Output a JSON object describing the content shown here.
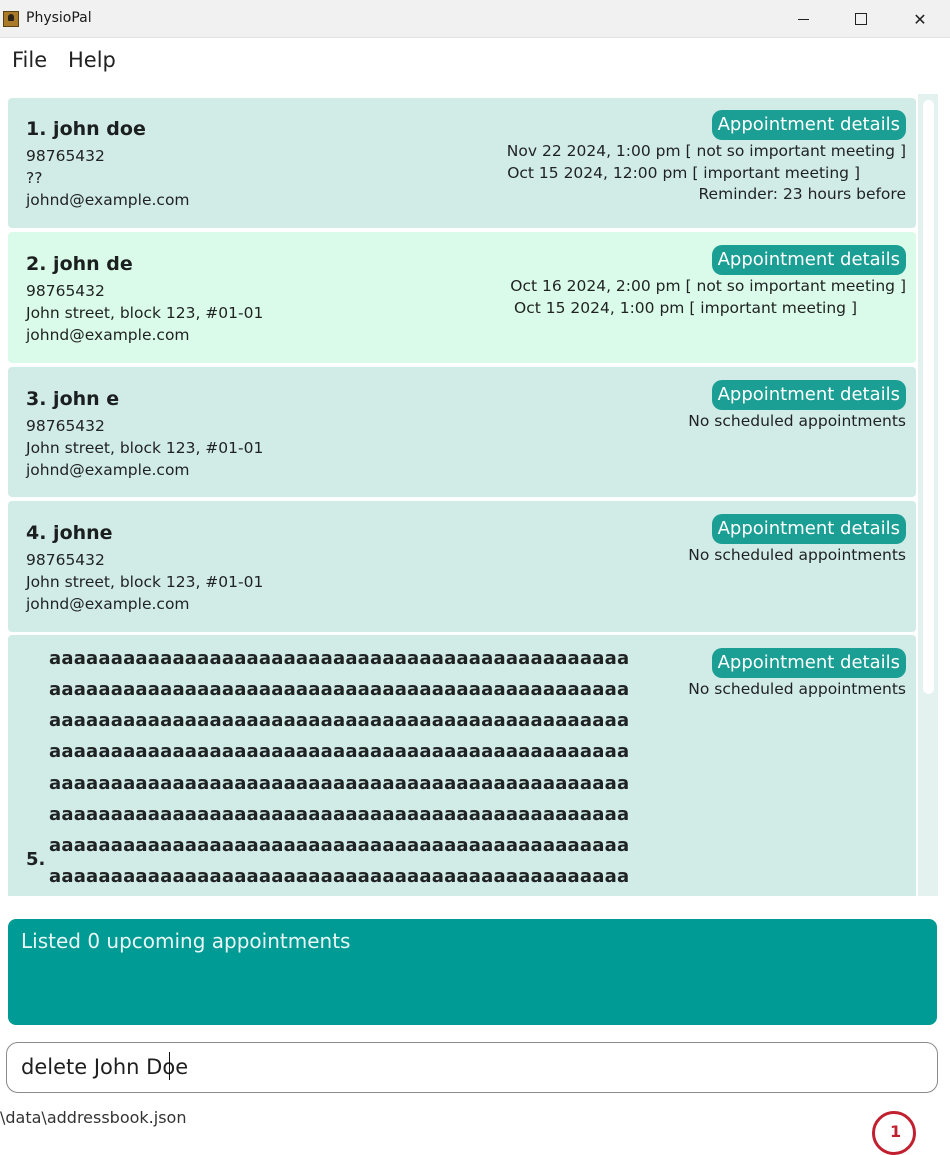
{
  "window": {
    "title": "PhysioPal",
    "minimize_label": "—",
    "maximize_label": "☐",
    "close_label": "✕"
  },
  "menu": {
    "items": [
      "File",
      "Help"
    ]
  },
  "patients": [
    {
      "name": "1. john doe",
      "phone": "98765432",
      "address": "??",
      "email": "johnd@example.com",
      "appointment_button": "Appointment details",
      "appointments": [
        "Nov 22 2024, 1:00 pm [ not so important meeting ]",
        "Oct 15 2024, 12:00 pm [ important meeting ]"
      ],
      "reminder": "Reminder: 23 hours before"
    },
    {
      "name": "2. john de",
      "phone": "98765432",
      "address": "John street, block 123, #01-01",
      "email": "johnd@example.com",
      "appointment_button": "Appointment details",
      "appointments": [
        "Oct 16 2024, 2:00 pm [ not so important meeting ]",
        "Oct 15 2024, 1:00 pm [ important meeting ]"
      ]
    },
    {
      "name": "3. john e",
      "phone": "98765432",
      "address": "John street, block 123, #01-01",
      "email": "johnd@example.com",
      "appointment_button": "Appointment details",
      "no_appointments": "No scheduled appointments"
    },
    {
      "name": "4. johne",
      "phone": "98765432",
      "address": "John street, block 123, #01-01",
      "email": "johnd@example.com",
      "appointment_button": "Appointment details",
      "no_appointments": "No scheduled appointments"
    },
    {
      "index": "5.",
      "name_lines": [
        "aaaaaaaaaaaaaaaaaaaaaaaaaaaaaaaaaaaaaaaaaaaaaaa",
        "aaaaaaaaaaaaaaaaaaaaaaaaaaaaaaaaaaaaaaaaaaaaaaa",
        "aaaaaaaaaaaaaaaaaaaaaaaaaaaaaaaaaaaaaaaaaaaaaaa",
        "aaaaaaaaaaaaaaaaaaaaaaaaaaaaaaaaaaaaaaaaaaaaaaa",
        "aaaaaaaaaaaaaaaaaaaaaaaaaaaaaaaaaaaaaaaaaaaaaaa",
        "aaaaaaaaaaaaaaaaaaaaaaaaaaaaaaaaaaaaaaaaaaaaaaa",
        "aaaaaaaaaaaaaaaaaaaaaaaaaaaaaaaaaaaaaaaaaaaaaaa",
        "aaaaaaaaaaaaaaaaaaaaaaaaaaaaaaaaaaaaaaaaaaaaaaa"
      ],
      "appointment_button": "Appointment details",
      "no_appointments": "No scheduled appointments"
    }
  ],
  "result": {
    "text": "Listed 0 upcoming appointments"
  },
  "command": {
    "value": "delete John Doe"
  },
  "status_bar": {
    "path": "\\data\\addressbook.json"
  }
}
